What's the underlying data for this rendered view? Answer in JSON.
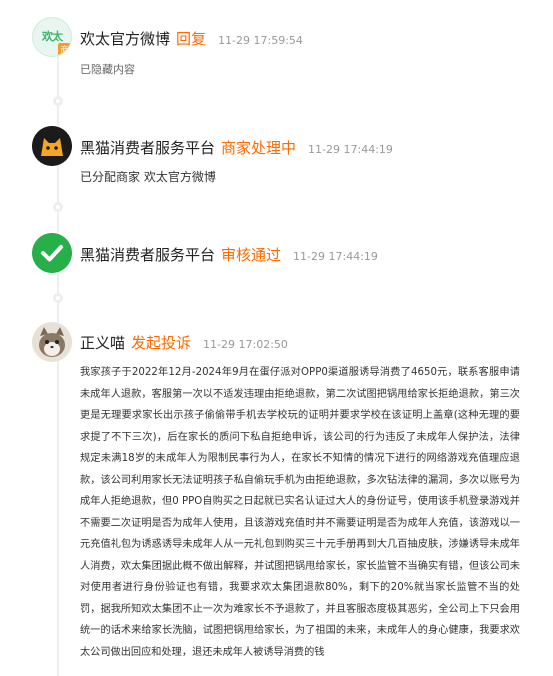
{
  "entries": [
    {
      "name": "欢太官方微博",
      "action": "回复",
      "time": "11-29 17:59:54",
      "body": "已隐藏内容",
      "avatar": {
        "icon": "huantai-logo-icon",
        "logo_text": "欢太",
        "badge_text": "商"
      }
    },
    {
      "name": "黑猫消费者服务平台",
      "action": "商家处理中",
      "time": "11-29 17:44:19",
      "body": "已分配商家 欢太官方微博",
      "avatar": {
        "icon": "black-cat-icon"
      }
    },
    {
      "name": "黑猫消费者服务平台",
      "action": "审核通过",
      "time": "11-29 17:44:19",
      "body": "",
      "avatar": {
        "icon": "check-circle-icon"
      }
    },
    {
      "name": "正义喵",
      "action": "发起投诉",
      "time": "11-29 17:02:50",
      "body": "我家孩子于2022年12月-2024年9月在蛋仔派对OPP0渠道服诱导消费了4650元，联系客服申请未成年人退款，客服第一次以不适发违理由拒绝退款，第二次试图把锅甩给家长拒绝退款，第三次更是无理要求家长出示孩子偷偷带手机去学校玩的证明并要求学校在该证明上盖章(这种无理的要求提了不下三次)，后在家长的质问下私自拒绝申诉，该公司的行为违反了未成年人保护法，法律规定未满18岁的未成年人为限制民事行为人，在家长不知情的情况下进行的网络游戏充值理应退款，该公司利用家长无法证明孩子私自偷玩手机为由拒绝退款，多次钻法律的漏洞，多次以账号为成年人拒绝退款，但0 PPO自购买之日起就已实名认证过大人的身份证号，使用该手机登录游戏并不需要二次证明是否为成年人使用，且该游戏充值时并不需要证明是否为成年人充值，该游戏以一元充值礼包为诱惑诱导未成年人从一元礼包到购买三十元手册再到大几百抽皮肤，涉嫌诱导未成年人消费，欢太集团据此概不做出解释，并试图把锅甩给家长，家长监管不当确实有错，但该公司未对使用者进行身份验证也有错，我要求欢太集团退款80%，剩下的20%就当家长监管不当的处罚，据我所知欢太集团不止一次为难家长不予退款了，并且客服态度极其恶劣，全公司上下只会用统一的话术来给家长洗脑，试图把锅甩给家长，为了祖国的未来，未成年人的身心健康，我要求欢太公司做出回应和处理，退还未成年人被诱导消费的钱",
      "avatar": {
        "icon": "cat-avatar-icon"
      }
    }
  ],
  "colors": {
    "accent": "#ff6a00",
    "time": "#999999",
    "check": "#27b04a"
  }
}
